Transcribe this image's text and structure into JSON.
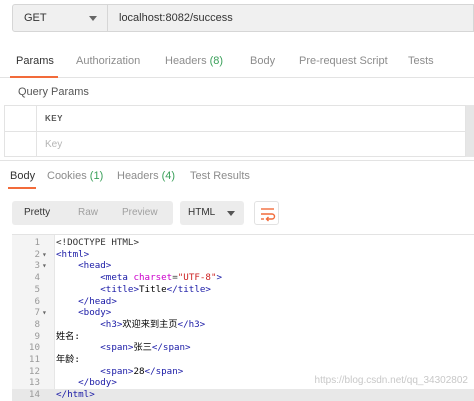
{
  "request": {
    "method": "GET",
    "url": "localhost:8082/success"
  },
  "request_tabs": [
    {
      "label": "Params",
      "count": ""
    },
    {
      "label": "Authorization",
      "count": ""
    },
    {
      "label": "Headers ",
      "count": "(8)"
    },
    {
      "label": "Body",
      "count": ""
    },
    {
      "label": "Pre-request Script",
      "count": ""
    },
    {
      "label": "Tests",
      "count": ""
    }
  ],
  "query_params": {
    "title": "Query Params",
    "key_header": "KEY",
    "key_placeholder": "Key"
  },
  "response_tabs": [
    {
      "label": "Body",
      "count": ""
    },
    {
      "label": "Cookies ",
      "count": "(1)"
    },
    {
      "label": "Headers ",
      "count": "(4)"
    },
    {
      "label": "Test Results",
      "count": ""
    }
  ],
  "view": {
    "pretty": "Pretty",
    "raw": "Raw",
    "preview": "Preview",
    "format": "HTML"
  },
  "code_lines": [
    {
      "n": "1",
      "fold": "",
      "html": "&lt;!DOCTYPE HTML&gt;"
    },
    {
      "n": "2",
      "fold": "▾",
      "html": "<span class='t'>&lt;html&gt;</span>"
    },
    {
      "n": "3",
      "fold": "▾",
      "html": "    <span class='t'>&lt;head&gt;</span>"
    },
    {
      "n": "4",
      "fold": "",
      "html": "        <span class='t'>&lt;meta</span> <span class='a'>charset</span>=<span class='v'>\"UTF-8\"</span><span class='t'>&gt;</span>"
    },
    {
      "n": "5",
      "fold": "",
      "html": "        <span class='t'>&lt;title&gt;</span><span class='tx'>Title</span><span class='t'>&lt;/title&gt;</span>"
    },
    {
      "n": "6",
      "fold": "",
      "html": "    <span class='t'>&lt;/head&gt;</span>"
    },
    {
      "n": "7",
      "fold": "▾",
      "html": "    <span class='t'>&lt;body&gt;</span>"
    },
    {
      "n": "8",
      "fold": "",
      "html": "        <span class='t'>&lt;h3&gt;</span><span class='tx'>欢迎来到主页</span><span class='t'>&lt;/h3&gt;</span>"
    },
    {
      "n": "9",
      "fold": "",
      "html": "<span class='tx'>姓名:</span>"
    },
    {
      "n": "10",
      "fold": "",
      "html": "        <span class='t'>&lt;span&gt;</span><span class='tx'>张三</span><span class='t'>&lt;/span&gt;</span>"
    },
    {
      "n": "11",
      "fold": "",
      "html": "<span class='tx'>年龄:</span>"
    },
    {
      "n": "12",
      "fold": "",
      "html": "        <span class='t'>&lt;span&gt;</span><span class='tx'>28</span><span class='t'>&lt;/span&gt;</span>"
    },
    {
      "n": "13",
      "fold": "",
      "html": "    <span class='t'>&lt;/body&gt;</span>"
    },
    {
      "n": "14",
      "fold": "",
      "html": "<span class='t'>&lt;/html&gt;</span>"
    }
  ],
  "watermark": "https://blog.csdn.net/qq_34302802",
  "colors": {
    "accent": "#f26b3a",
    "count": "#3aa05a"
  }
}
